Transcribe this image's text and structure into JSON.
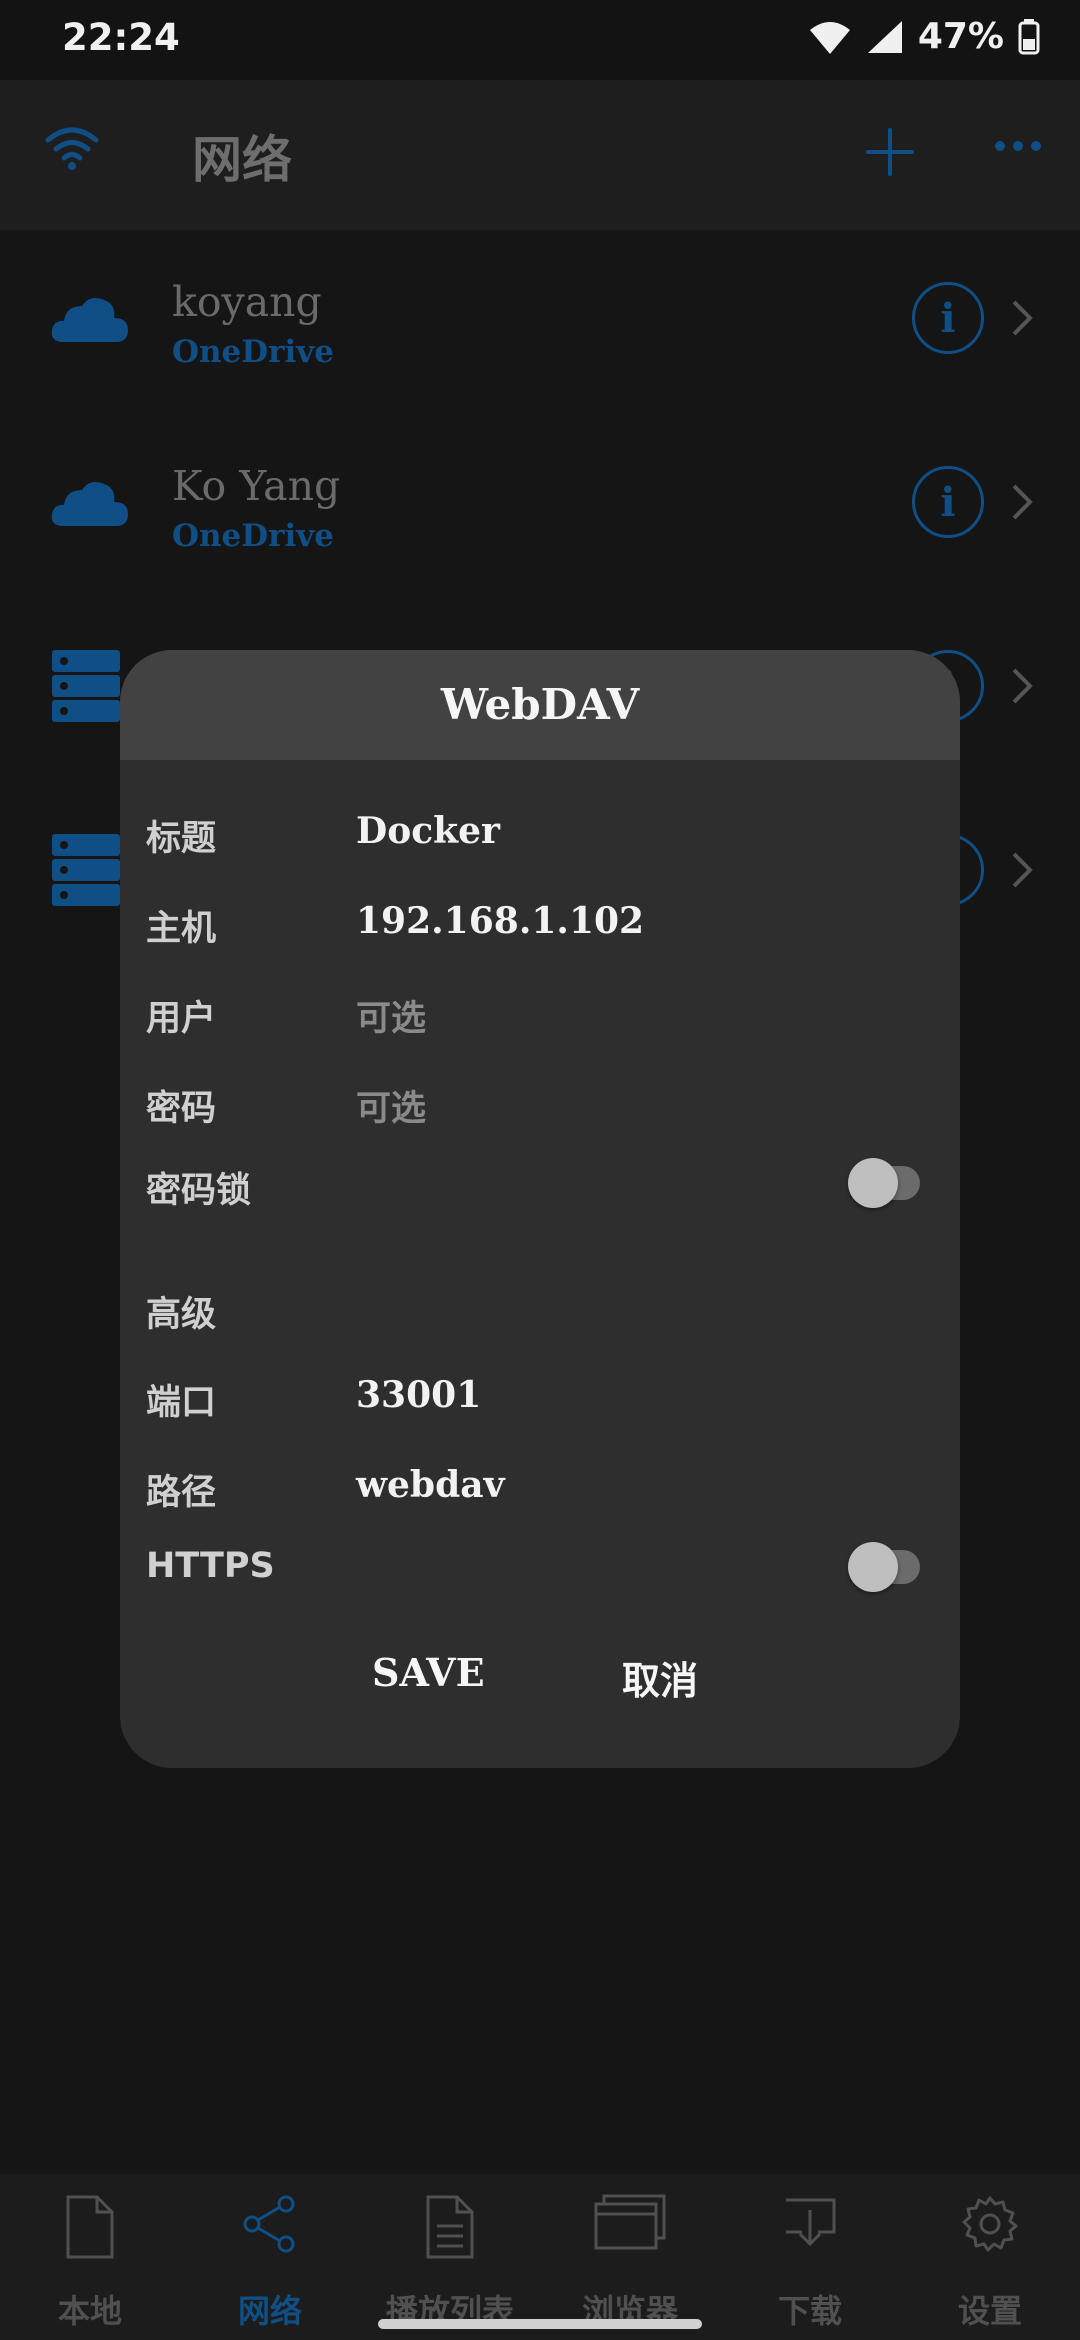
{
  "status": {
    "time": "22:24",
    "battery": "47%"
  },
  "appbar": {
    "title": "网络",
    "left_icon": "wifi-icon",
    "add_icon": "plus-icon",
    "more_icon": "more-icon"
  },
  "connections": [
    {
      "name": "koyang",
      "type": "OneDrive",
      "icon": "cloud-icon"
    },
    {
      "name": "Ko Yang",
      "type": "OneDrive",
      "icon": "cloud-icon"
    },
    {
      "name": "",
      "type": "",
      "icon": "server-icon"
    },
    {
      "name": "",
      "type": "",
      "icon": "server-icon"
    }
  ],
  "dialog": {
    "title": "WebDAV",
    "title_label": "标题",
    "title_value": "Docker",
    "host_label": "主机",
    "host_value": "192.168.1.102",
    "user_label": "用户",
    "user_placeholder": "可选",
    "password_label": "密码",
    "password_placeholder": "可选",
    "password_lock_label": "密码锁",
    "password_lock_on": false,
    "advanced_label": "高级",
    "port_label": "端口",
    "port_value": "33001",
    "path_label": "路径",
    "path_value": "webdav",
    "https_label": "HTTPS",
    "https_on": false,
    "save_label": "SAVE",
    "cancel_label": "取消"
  },
  "nav": {
    "items": [
      {
        "label": "本地",
        "icon": "file-icon"
      },
      {
        "label": "网络",
        "icon": "share-icon",
        "active": true
      },
      {
        "label": "播放列表",
        "icon": "playlist-icon"
      },
      {
        "label": "浏览器",
        "icon": "browser-icon"
      },
      {
        "label": "下载",
        "icon": "download-icon"
      },
      {
        "label": "设置",
        "icon": "gear-icon"
      }
    ]
  },
  "colors": {
    "accent": "#0f4f86",
    "dialog_bg": "#2e2e2e",
    "dialog_header": "#424242"
  }
}
